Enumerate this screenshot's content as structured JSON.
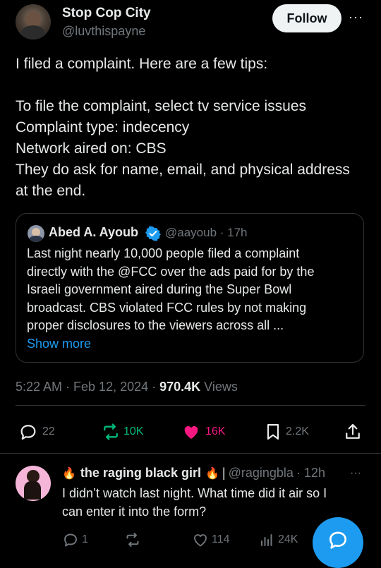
{
  "tweet": {
    "author_name": "Stop Cop City",
    "author_handle": "@luvthispayne",
    "follow_label": "Follow",
    "more_glyph": "···",
    "text_lines": [
      "I filed a complaint. Here are a few tips:",
      "To file the complaint, select tv service issues",
      "Complaint type: indecency",
      "Network aired on: CBS",
      "They do ask for name, email, and physical address",
      "at the end."
    ],
    "timestamp": "5:22 AM · Feb 12, 2024 · ",
    "views_count": "970.4K",
    "views_label": " Views"
  },
  "quote": {
    "author_name": "Abed A. Ayoub",
    "author_handle": "@aayoub · 17h",
    "text_lines": [
      "Last night nearly 10,000 people filed a complaint",
      "directly with the @FCC over the ads paid for by the",
      "Israeli government aired during the Super Bowl",
      "broadcast. CBS violated FCC rules by not making",
      "proper disclosures to the viewers across all ..."
    ],
    "show_more": "Show more"
  },
  "actions": {
    "replies": "22",
    "reposts": "10K",
    "likes": "16K",
    "bookmarks": "2.2K"
  },
  "reply": {
    "author_name": "the raging black girl",
    "separator": "|",
    "author_handle": "@ragingbla",
    "time": "· 12h",
    "more_glyph": "···",
    "text_lines": [
      "I didn’t watch last night. What time did it air so I",
      "can enter it into the form?"
    ],
    "replies": "1",
    "likes": "114",
    "views": "24K"
  },
  "colors": {
    "accent": "#1d9bf0",
    "repost": "#00ba7c",
    "like": "#f91880",
    "muted": "#71767b",
    "border": "#2f3336"
  }
}
